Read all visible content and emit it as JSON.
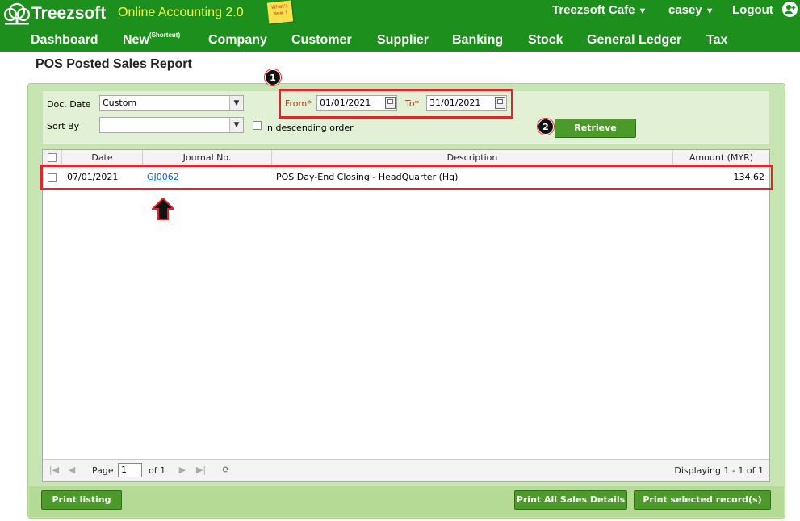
{
  "app": {
    "logo_text": "Treezsoft",
    "subtitle": "Online Accounting 2.0",
    "whats_new": "What's New !",
    "company": "Treezsoft Cafe",
    "user": "casey",
    "logout": "Logout"
  },
  "nav": {
    "dashboard": "Dashboard",
    "new": "New",
    "new_sup": "(Shortcut)",
    "company": "Company",
    "customer": "Customer",
    "supplier": "Supplier",
    "banking": "Banking",
    "stock": "Stock",
    "general_ledger": "General Ledger",
    "tax": "Tax"
  },
  "page": {
    "title": "POS Posted Sales Report"
  },
  "filters": {
    "doc_date_label": "Doc. Date",
    "doc_date_value": "Custom",
    "sort_by_label": "Sort By",
    "sort_by_value": "",
    "descending_label": "in descending order",
    "from_label": "From*",
    "from_value": "01/01/2021",
    "to_label": "To*",
    "to_value": "31/01/2021",
    "retrieve_label": "Retrieve"
  },
  "annotations": {
    "badge1": "1",
    "badge2": "2"
  },
  "table": {
    "columns": {
      "date": "Date",
      "journal": "Journal No.",
      "description": "Description",
      "amount": "Amount (MYR)"
    },
    "rows": [
      {
        "date": "07/01/2021",
        "journal": "GJ0062",
        "description": "POS Day-End Closing - HeadQuarter (Hq)",
        "amount": "134.62"
      }
    ]
  },
  "pager": {
    "page_label": "Page",
    "page_value": "1",
    "of_label": "of 1",
    "displaying": "Displaying 1 - 1 of 1"
  },
  "buttons": {
    "print_listing": "Print listing",
    "print_all": "Print All Sales Details",
    "print_selected": "Print selected record(s)"
  },
  "colors": {
    "header_green": "#1c8f1c",
    "button_green": "#4c9a2a",
    "highlight_red": "#e2252b"
  }
}
